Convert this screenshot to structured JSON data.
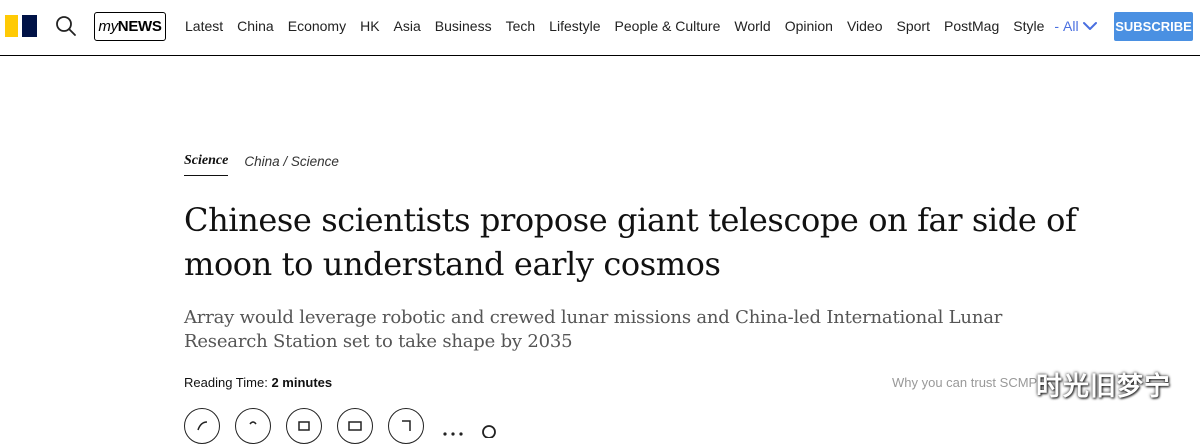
{
  "header": {
    "search_icon": "search-icon",
    "mynews": {
      "my": "my",
      "news": "NEWS"
    },
    "nav": [
      "Latest",
      "China",
      "Economy",
      "HK",
      "Asia",
      "Business",
      "Tech",
      "Lifestyle",
      "People & Culture",
      "World",
      "Opinion",
      "Video",
      "Sport",
      "PostMag",
      "Style"
    ],
    "all_dash": "-",
    "all_label": "All",
    "subscribe_label": "SUBSCRIBE"
  },
  "article": {
    "section_primary": "Science",
    "section_secondary_1": "China",
    "section_separator": "/",
    "section_secondary_2": "Science",
    "headline": "Chinese scientists propose giant telescope on far side of moon to understand early cosmos",
    "subheadline": "Array would leverage robotic and crewed lunar missions and China-led International Lunar Research Station set to take shape by 2035",
    "reading_time_label": "Reading Time:",
    "reading_time_value": "2 minutes",
    "trust_link": "Why you can trust SCMP"
  },
  "watermark": "时光旧梦宁",
  "colors": {
    "logo_yellow": "#ffca05",
    "logo_navy": "#001246",
    "accent_blue": "#4a6fe0",
    "subscribe_bg": "#4a90e2"
  }
}
